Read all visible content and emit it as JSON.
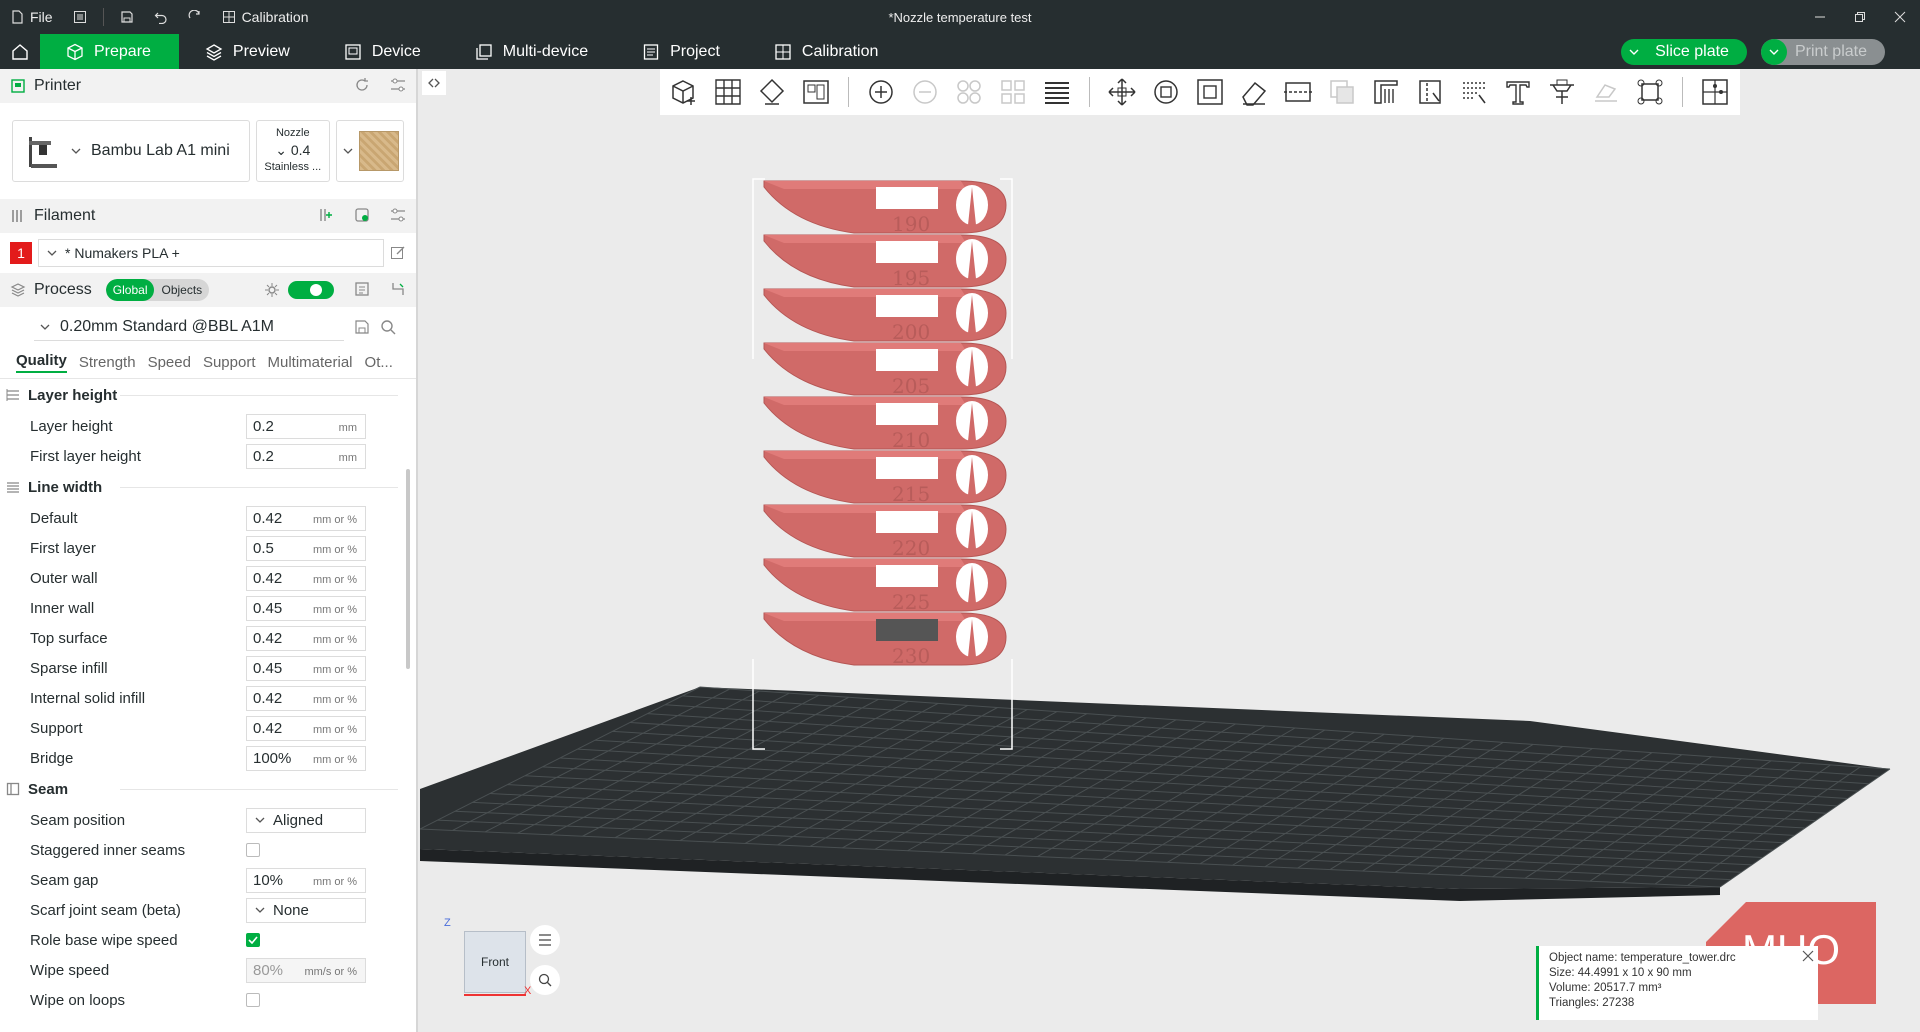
{
  "titlebar": {
    "file_label": "File",
    "calibration_label": "Calibration",
    "window_title": "*Nozzle temperature test"
  },
  "tabs": [
    {
      "label": "Prepare",
      "icon": "cube-icon",
      "active": true
    },
    {
      "label": "Preview",
      "icon": "layers-icon",
      "active": false
    },
    {
      "label": "Device",
      "icon": "device-icon",
      "active": false
    },
    {
      "label": "Multi-device",
      "icon": "multi-device-icon",
      "active": false
    },
    {
      "label": "Project",
      "icon": "project-icon",
      "active": false
    },
    {
      "label": "Calibration",
      "icon": "calibration-icon",
      "active": false
    }
  ],
  "actions": {
    "slice": "Slice plate",
    "print": "Print plate"
  },
  "printer": {
    "section_title": "Printer",
    "name": "Bambu Lab A1 mini",
    "nozzle_label": "Nozzle",
    "nozzle_value": "0.4",
    "nozzle_material": "Stainless ..."
  },
  "filament": {
    "section_title": "Filament",
    "slot": "1",
    "slot_color": "#e31b1b",
    "name": "* Numakers PLA +"
  },
  "process": {
    "section_title": "Process",
    "seg_global": "Global",
    "seg_objects": "Objects",
    "preset": "0.20mm Standard @BBL A1M",
    "subtabs": [
      "Quality",
      "Strength",
      "Speed",
      "Support",
      "Multimaterial",
      "Ot..."
    ]
  },
  "settings": {
    "layer_height_group": "Layer height",
    "line_width_group": "Line width",
    "seam_group": "Seam",
    "layer_height": [
      {
        "label": "Layer height",
        "value": "0.2",
        "unit": "mm"
      },
      {
        "label": "First layer height",
        "value": "0.2",
        "unit": "mm"
      }
    ],
    "line_width": [
      {
        "label": "Default",
        "value": "0.42",
        "unit": "mm or %"
      },
      {
        "label": "First layer",
        "value": "0.5",
        "unit": "mm or %"
      },
      {
        "label": "Outer wall",
        "value": "0.42",
        "unit": "mm or %"
      },
      {
        "label": "Inner wall",
        "value": "0.45",
        "unit": "mm or %"
      },
      {
        "label": "Top surface",
        "value": "0.42",
        "unit": "mm or %"
      },
      {
        "label": "Sparse infill",
        "value": "0.45",
        "unit": "mm or %"
      },
      {
        "label": "Internal solid infill",
        "value": "0.42",
        "unit": "mm or %"
      },
      {
        "label": "Support",
        "value": "0.42",
        "unit": "mm or %"
      },
      {
        "label": "Bridge",
        "value": "100%",
        "unit": "mm or %"
      }
    ],
    "seam": {
      "seam_position_label": "Seam position",
      "seam_position_value": "Aligned",
      "staggered_label": "Staggered inner seams",
      "seam_gap_label": "Seam gap",
      "seam_gap_value": "10%",
      "seam_gap_unit": "mm or %",
      "scarf_label": "Scarf joint seam (beta)",
      "scarf_value": "None",
      "role_wipe_label": "Role base wipe speed",
      "wipe_speed_label": "Wipe speed",
      "wipe_speed_value": "80%",
      "wipe_speed_unit": "mm/s or %",
      "wipe_loops_label": "Wipe on loops"
    }
  },
  "viewport": {
    "cube_face": "Front",
    "axis_z": "Z",
    "axis_x": "X",
    "tower_labels": [
      "190",
      "195",
      "200",
      "205",
      "210",
      "215",
      "220",
      "225",
      "230"
    ],
    "model_color": "#d06a68"
  },
  "info": {
    "object_name": "Object name: temperature_tower.drc",
    "size": "Size: 44.4991 x 10 x 90 mm",
    "volume": "Volume: 20517.7 mm³",
    "triangles": "Triangles: 27238"
  },
  "watermark": "MUO",
  "colors": {
    "accent": "#00ae42",
    "dark": "#262e30"
  }
}
